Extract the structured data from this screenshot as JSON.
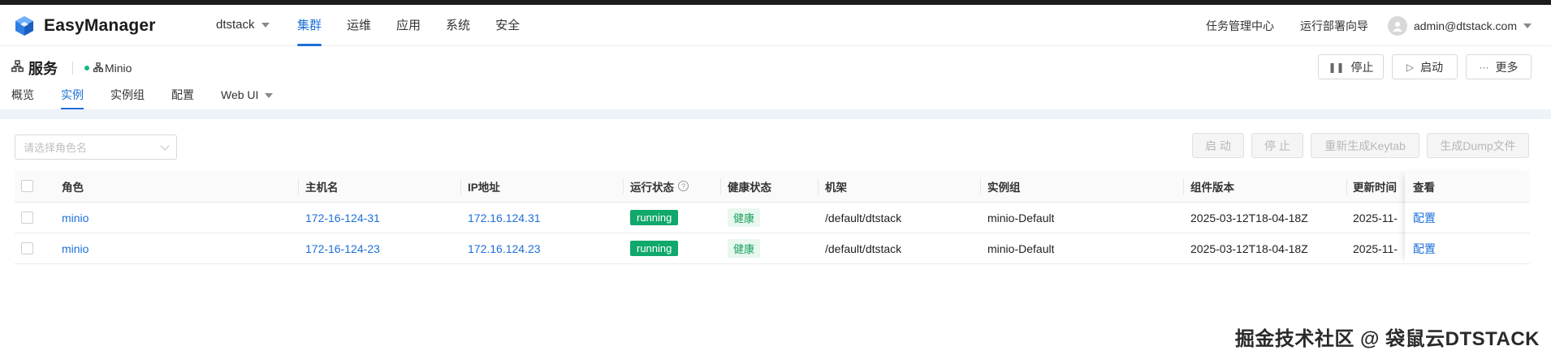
{
  "app": {
    "name": "EasyManager"
  },
  "header": {
    "cluster": "dtstack",
    "nav": [
      "集群",
      "运维",
      "应用",
      "系统",
      "安全"
    ],
    "active_nav": "集群",
    "task_center": "任务管理中心",
    "deploy_wizard": "运行部署向导",
    "user": "admin@dtstack.com"
  },
  "page": {
    "title": "服务",
    "service_name": "Minio",
    "actions": {
      "stop": "停止",
      "start": "启动",
      "more": "更多"
    },
    "tabs": [
      "概览",
      "实例",
      "实例组",
      "配置",
      "Web UI"
    ],
    "active_tab": "实例"
  },
  "toolbar": {
    "role_placeholder": "请选择角色名",
    "start": "启 动",
    "stop": "停 止",
    "regen_keytab": "重新生成Keytab",
    "gen_dump": "生成Dump文件"
  },
  "table": {
    "columns": [
      "角色",
      "主机名",
      "IP地址",
      "运行状态",
      "健康状态",
      "机架",
      "实例组",
      "组件版本",
      "更新时间",
      "查看"
    ],
    "rows": [
      {
        "role": "minio",
        "host": "172-16-124-31",
        "ip": "172.16.124.31",
        "run_status": "running",
        "health": "健康",
        "rack": "/default/dtstack",
        "group": "minio-Default",
        "version": "2025-03-12T18-04-18Z",
        "updated": "2025-11-",
        "view": "配置"
      },
      {
        "role": "minio",
        "host": "172-16-124-23",
        "ip": "172.16.124.23",
        "run_status": "running",
        "health": "健康",
        "rack": "/default/dtstack",
        "group": "minio-Default",
        "version": "2025-03-12T18-04-18Z",
        "updated": "2025-11-",
        "view": "配置"
      }
    ]
  },
  "watermark": "掘金技术社区 @ 袋鼠云DTSTACK",
  "colors": {
    "primary": "#1d6fd8",
    "running": "#11a86b",
    "healthy": "#19a15e"
  }
}
